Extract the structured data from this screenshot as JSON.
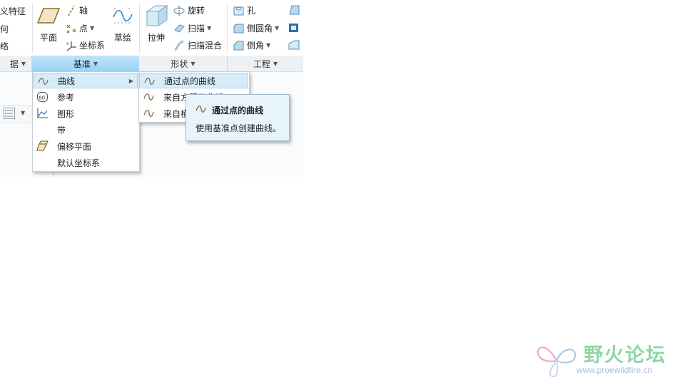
{
  "ribbon": {
    "left_col": [
      "义特征",
      "何",
      "络"
    ],
    "plane_label": "平面",
    "axis_label": "轴",
    "point_label": "点",
    "csys_label": "坐标系",
    "sketch_label": "草绘",
    "extrude_label": "拉伸",
    "revolve_label": "旋转",
    "sweep_label": "扫描",
    "swept_blend_label": "扫描混合",
    "hole_label": "孔",
    "round_label": "倒圆角",
    "chamfer_label": "倒角"
  },
  "groups": {
    "data_label": "据",
    "datum_label": "基准",
    "shapes_label": "形状",
    "engineering_label": "工程"
  },
  "datum_menu": {
    "items": [
      "曲线",
      "参考",
      "图形",
      "带",
      "偏移平面",
      "默认坐标系"
    ]
  },
  "curve_submenu": {
    "items": [
      "通过点的曲线",
      "来自方程的曲线",
      "来自横截面的曲线"
    ]
  },
  "tooltip": {
    "title": "通过点的曲线",
    "body": "使用基准点创建曲线。"
  },
  "watermark": {
    "title": "野火论坛",
    "url": "www.proewildfire.cn"
  },
  "colors": {
    "selected_group": "#9cd3f4",
    "highlight": "#d6ecfa",
    "curve_icon": "#7a6a3a",
    "watermark_green": "#8fd6a6"
  }
}
